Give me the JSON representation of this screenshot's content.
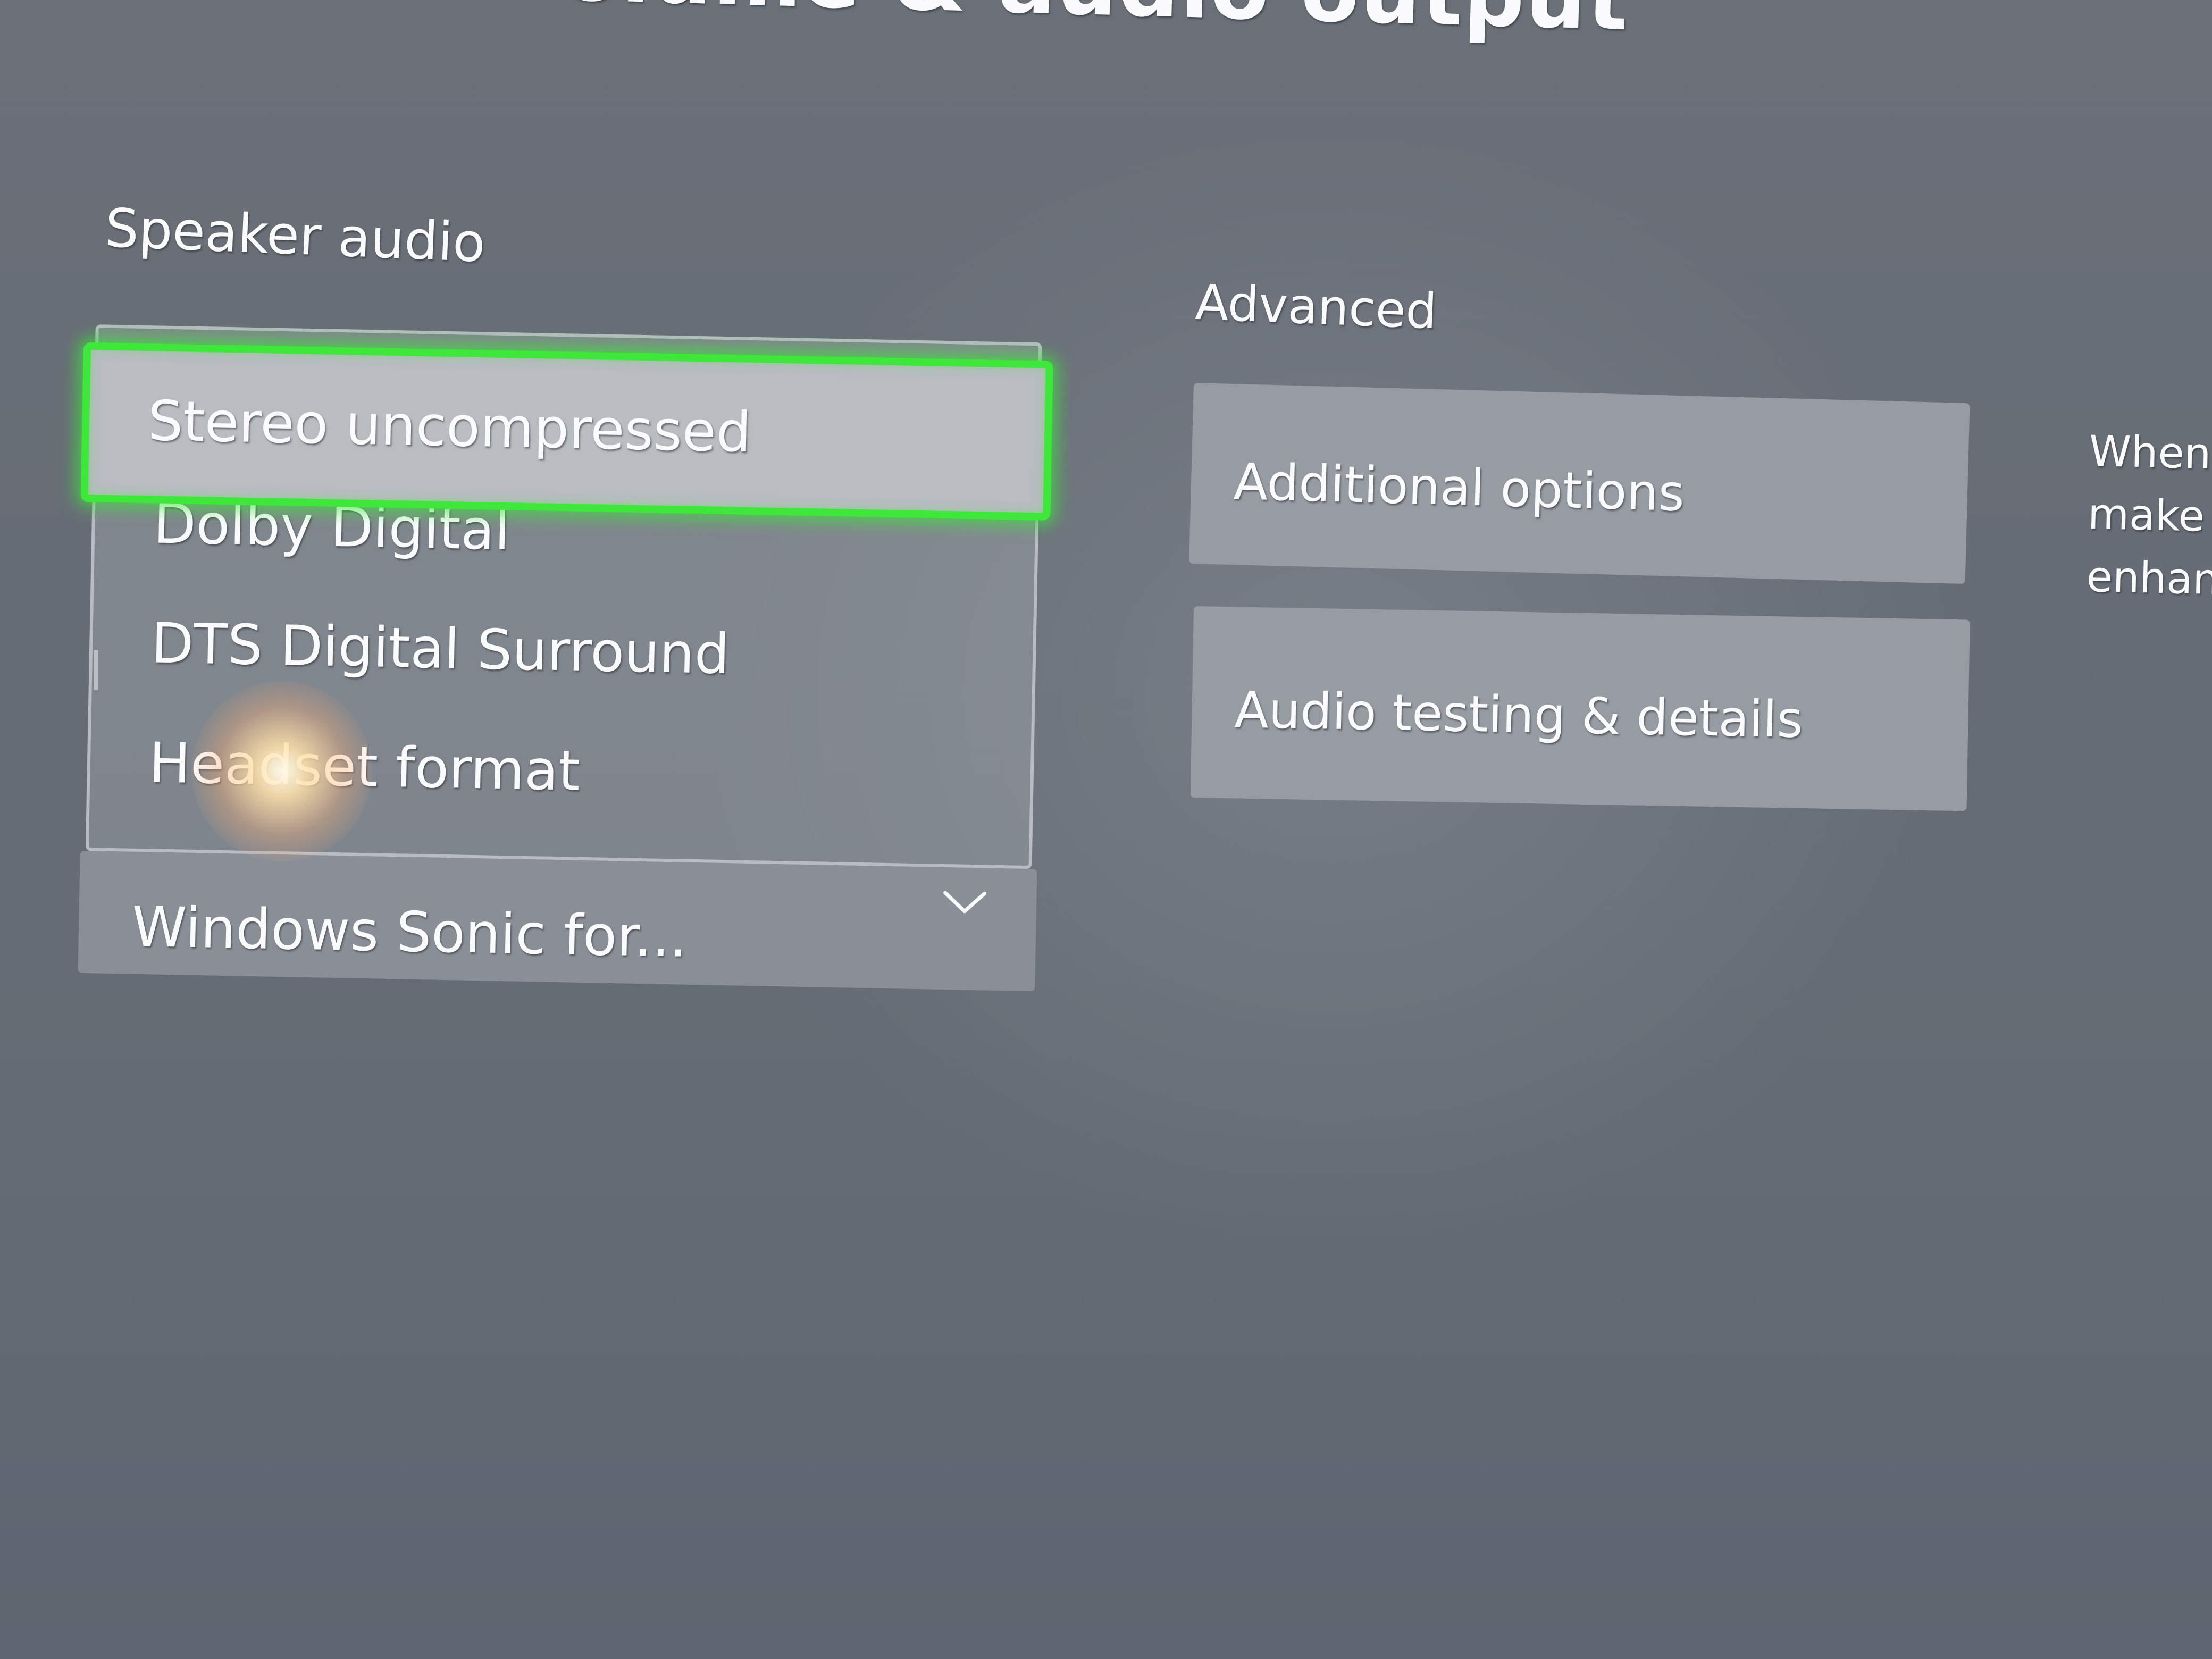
{
  "page": {
    "title": "Volume & audio output",
    "title_visible": "olume & audio output"
  },
  "speaker_audio": {
    "header": "Speaker audio",
    "dropdown": {
      "state": "expanded",
      "options": [
        {
          "label": "Stereo uncompressed",
          "focused": true
        },
        {
          "label": "Dolby Digital",
          "focused": false
        },
        {
          "label": "DTS Digital Surround",
          "focused": false
        },
        {
          "label": "Headset format",
          "focused": false
        }
      ],
      "selected_value": "Windows Sonic for...",
      "chevron_icon": "chevron-down-icon"
    }
  },
  "advanced": {
    "header": "Advanced",
    "tiles": [
      {
        "label": "Additional options"
      },
      {
        "label": "Audio testing & details"
      }
    ]
  },
  "help_text": {
    "lines": [
      "When",
      "make s",
      "enhanc"
    ]
  },
  "colors": {
    "focus_ring": "#3ee83a",
    "background": "#666c75",
    "tile": "#979ca3",
    "text": "#fbfbfd"
  }
}
